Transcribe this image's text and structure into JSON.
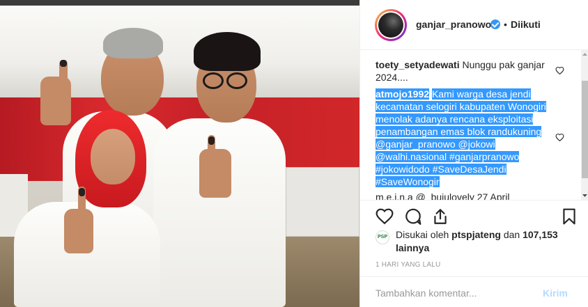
{
  "post": {
    "username": "ganjar_pranowo",
    "separator": "•",
    "follow_status": "Diikuti"
  },
  "comments": [
    {
      "user": "toety_setyadewati",
      "text": "Nunggu pak ganjar 2024...."
    },
    {
      "user": "atmojo1992",
      "text": "Kami warga desa jendi kecamatan selogiri kabupaten Wonogiri menolak adanya rencana eksploitasi penambangan emas blok randukuning @ganjar_pranowo @jokowi @walhi.nasional #ganjarpranowo #jokowidodo #SaveDesaJendi #SaveWonogir"
    },
    {
      "user": "",
      "text": "m.e.i.n.a @_buiulovely 27 April"
    }
  ],
  "likes": {
    "liked_by_label": "Disukai oleh",
    "liked_by_user": "ptspjateng",
    "and_label": "dan",
    "count": "107,153",
    "others_label": "lainnya",
    "avatar_text": "PSP"
  },
  "timestamp": "1 HARI YANG LALU",
  "composer": {
    "placeholder": "Tambahkan komentar...",
    "post_label": "Kirim"
  },
  "colors": {
    "verified": "#3897f0",
    "selection": "#3399ff",
    "link_disabled": "#b3dbff"
  }
}
